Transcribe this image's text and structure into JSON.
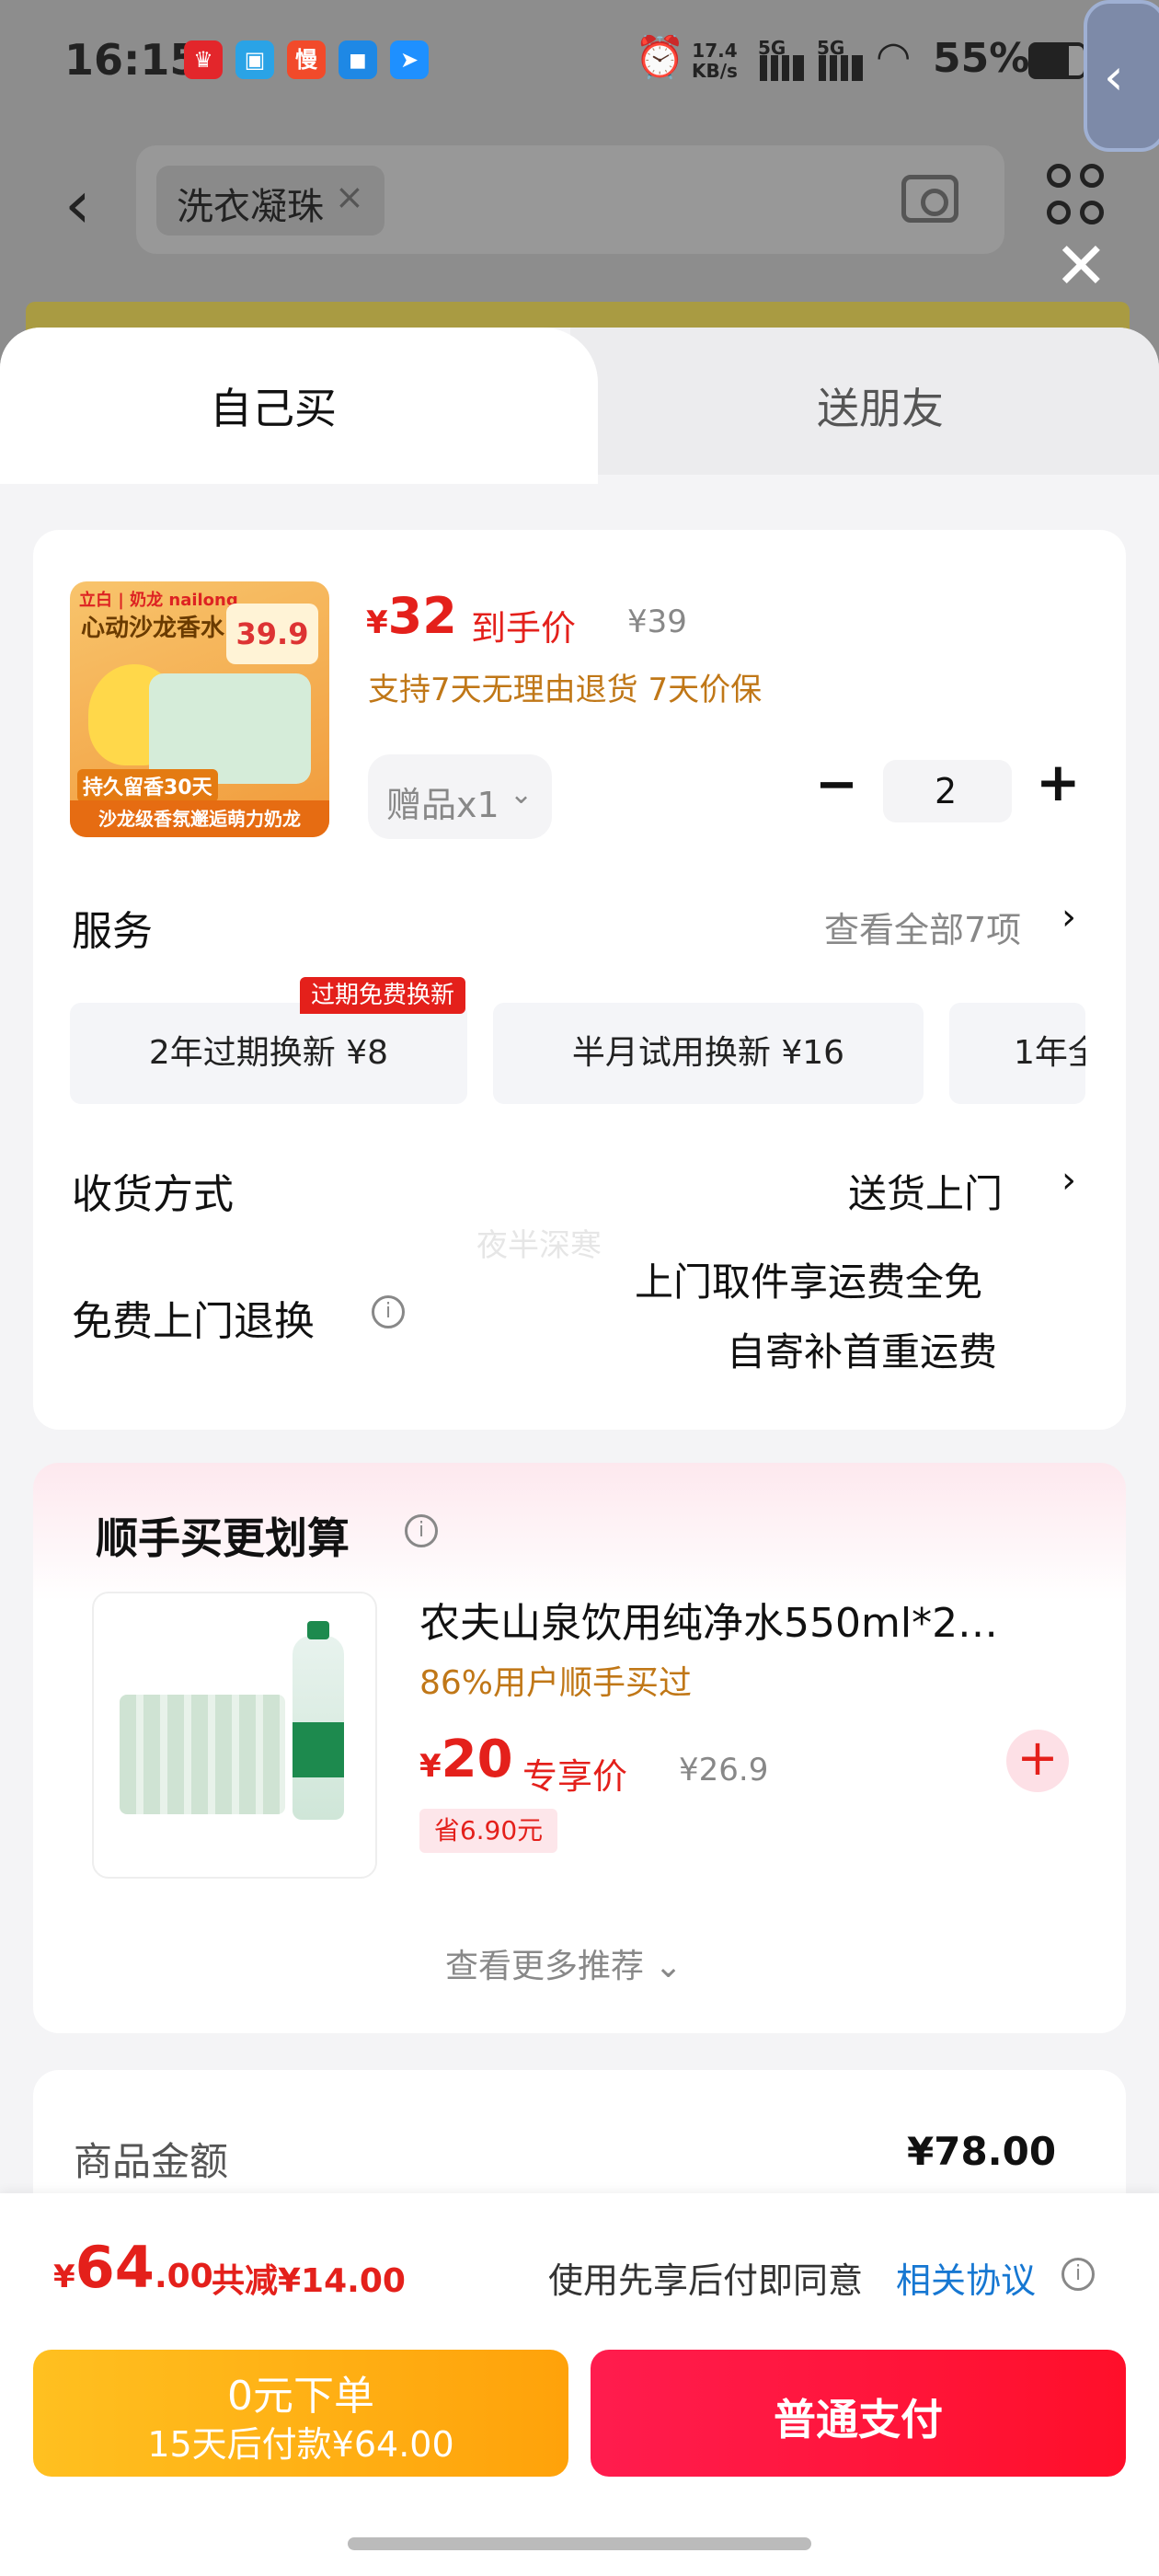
{
  "status_bar": {
    "time": "16:15",
    "apps": [
      {
        "icon": "app-red-icon",
        "glyph": "♛",
        "color": "#e3262b"
      },
      {
        "icon": "app-blue-icon",
        "glyph": "▣",
        "color": "#2aa3e6"
      },
      {
        "icon": "app-man-icon",
        "glyph": "慢",
        "color": "#f24a2a"
      },
      {
        "icon": "app-chat-icon",
        "glyph": "◼",
        "color": "#1e88e5"
      },
      {
        "icon": "app-nav-icon",
        "glyph": "➤",
        "color": "#1e90ff"
      }
    ],
    "net_speed_value": "17.4",
    "net_speed_unit": "KB/s",
    "network_1": "5G",
    "network_2": "5G",
    "battery": "55%"
  },
  "search": {
    "chip_text": "洗衣凝珠",
    "chip_close": "×"
  },
  "tabs": {
    "self": "自己买",
    "friend": "送朋友"
  },
  "product": {
    "image": {
      "brand": "立白 | 奶龙 nailong",
      "headline": "心动沙龙香水",
      "price_tag": "39.9",
      "days": "持久留香30天",
      "bottom": "沙龙级香氛邂逅萌力奶龙"
    },
    "price_symbol": "¥",
    "price": "32",
    "price_label": "到手价",
    "original_price": "¥39",
    "support": "支持7天无理由退货  7天价保",
    "gift": "赠品x1",
    "gift_arrow": "⌄",
    "minus": "−",
    "quantity": "2",
    "plus": "+"
  },
  "services": {
    "title": "服务",
    "view_all": "查看全部7项",
    "chevron": "›",
    "badge": "过期免费换新",
    "items": [
      {
        "label": "2年过期换新  ¥8"
      },
      {
        "label": "半月试用换新  ¥16"
      },
      {
        "label": "1年全"
      }
    ]
  },
  "delivery": {
    "title": "收货方式",
    "value": "送货上门",
    "chevron": "›"
  },
  "returns": {
    "title": "免费上门退换",
    "info": "i",
    "line1": "上门取件享运费全免",
    "line2": "自寄补首重运费"
  },
  "watermark": "夜半深寒",
  "upsell": {
    "title": "顺手买更划算",
    "info": "i",
    "name": "农夫山泉饮用纯净水550ml*2…",
    "users": "86%用户顺手买过",
    "price_symbol": "¥",
    "price": "20",
    "price_label": "专享价",
    "original_price": "¥26.9",
    "save": "省6.90元",
    "add": "+",
    "more": "查看更多推荐 ⌄"
  },
  "amount": {
    "label": "商品金额",
    "value": "¥78.00"
  },
  "footer": {
    "total_symbol": "¥",
    "total_int": "64",
    "total_dec": ".00",
    "reduced": "共减¥14.00",
    "agree_prefix": "使用先享后付即同意",
    "agree_link": "相关协议",
    "info": "i",
    "pay_later_title": "0元下单",
    "pay_later_sub": "15天后付款¥64.00",
    "pay_normal": "普通支付"
  },
  "colors": {
    "accent_red": "#e4201b",
    "accent_orange": "#c07717",
    "link_blue": "#1677d2"
  }
}
